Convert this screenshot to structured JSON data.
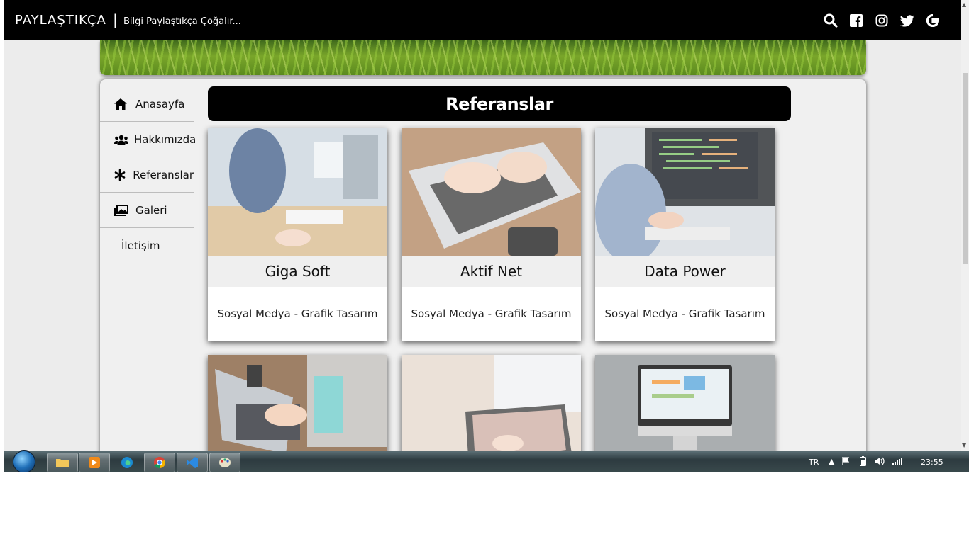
{
  "header": {
    "brand": "PAYLAŞTIKÇA",
    "separator": "|",
    "tagline": "Bilgi Paylaştıkça Çoğalır...",
    "icons": [
      "search-icon",
      "facebook-icon",
      "instagram-icon",
      "twitter-icon",
      "google-icon"
    ]
  },
  "sidebar": {
    "items": [
      {
        "label": "Anasayfa",
        "icon": "home-icon"
      },
      {
        "label": "Hakkımızda",
        "icon": "users-icon"
      },
      {
        "label": "Referanslar",
        "icon": "asterisk-icon"
      },
      {
        "label": "Galeri",
        "icon": "images-icon"
      },
      {
        "label": "İletişim",
        "icon": ""
      }
    ]
  },
  "main": {
    "title": "Referanslar",
    "cards": [
      {
        "name": "Giga Soft",
        "desc": "Sosyal Medya - Grafik Tasarım"
      },
      {
        "name": "Aktif Net",
        "desc": "Sosyal Medya - Grafik Tasarım"
      },
      {
        "name": "Data Power",
        "desc": "Sosyal Medya - Grafik Tasarım"
      }
    ]
  },
  "taskbar": {
    "language": "TR",
    "clock": "23:55",
    "apps": [
      "file-explorer-icon",
      "media-player-icon",
      "edge-icon",
      "chrome-icon",
      "vscode-icon",
      "paint-icon"
    ]
  }
}
